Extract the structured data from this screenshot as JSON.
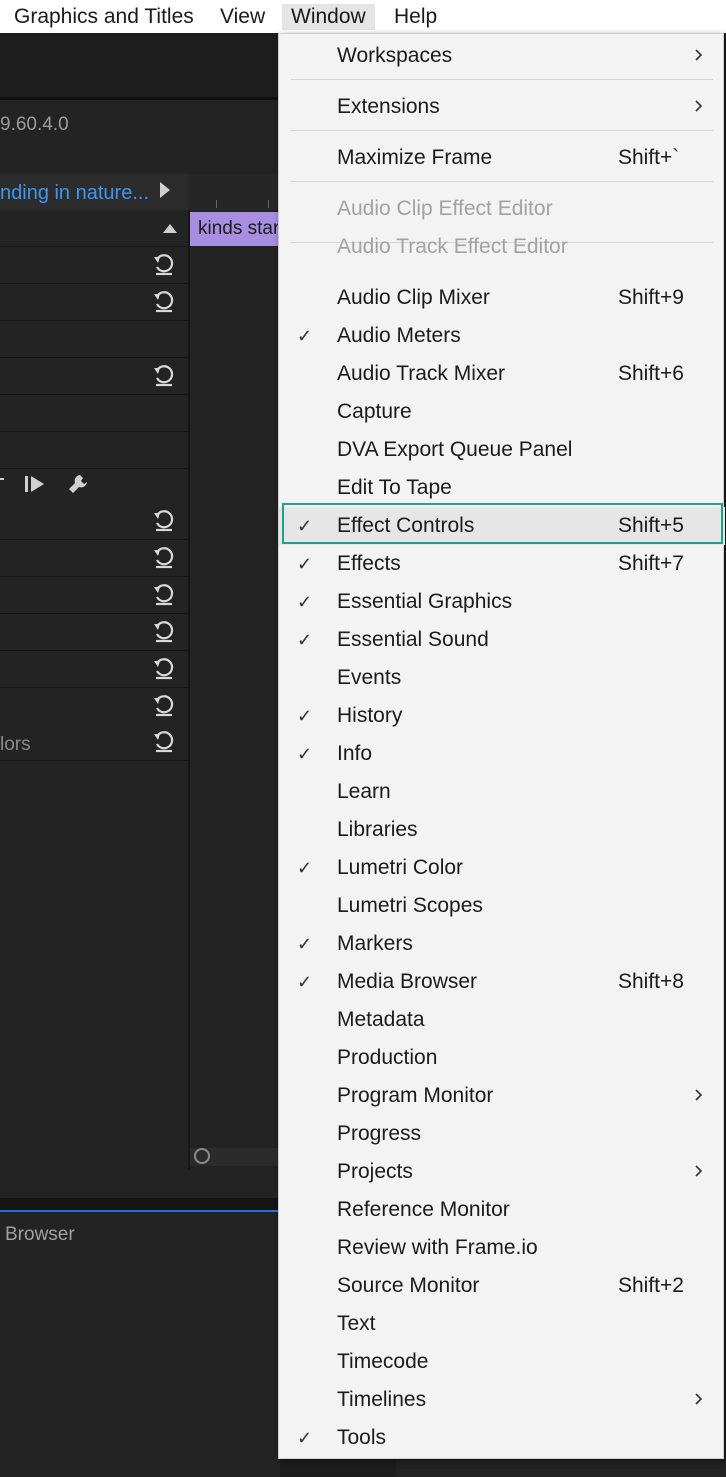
{
  "menubar": {
    "items": [
      "Graphics and Titles",
      "View",
      "Window",
      "Help"
    ]
  },
  "panel": {
    "version": "9.60.4.0",
    "clip_title": "nding in nature...",
    "timeline_clip": "kinds star",
    "row_label": "lors",
    "browser_tab": "Browser"
  },
  "window_menu": {
    "items": [
      {
        "label": "Workspaces",
        "shortcut": "",
        "checked": false,
        "submenu": true,
        "disabled": false
      },
      {
        "label": "Extensions",
        "shortcut": "",
        "checked": false,
        "submenu": true,
        "disabled": false
      },
      {
        "label": "Maximize Frame",
        "shortcut": "Shift+`",
        "checked": false,
        "submenu": false,
        "disabled": false
      },
      {
        "label": "Audio Clip Effect Editor",
        "shortcut": "",
        "checked": false,
        "submenu": false,
        "disabled": true
      },
      {
        "label": "Audio Track Effect Editor",
        "shortcut": "",
        "checked": false,
        "submenu": false,
        "disabled": true
      },
      {
        "label": "Audio Clip Mixer",
        "shortcut": "Shift+9",
        "checked": false,
        "submenu": false,
        "disabled": false
      },
      {
        "label": "Audio Meters",
        "shortcut": "",
        "checked": true,
        "submenu": false,
        "disabled": false
      },
      {
        "label": "Audio Track Mixer",
        "shortcut": "Shift+6",
        "checked": false,
        "submenu": false,
        "disabled": false
      },
      {
        "label": "Capture",
        "shortcut": "",
        "checked": false,
        "submenu": false,
        "disabled": false
      },
      {
        "label": "DVA Export Queue Panel",
        "shortcut": "",
        "checked": false,
        "submenu": false,
        "disabled": false
      },
      {
        "label": "Edit To Tape",
        "shortcut": "",
        "checked": false,
        "submenu": false,
        "disabled": false
      },
      {
        "label": "Effect Controls",
        "shortcut": "Shift+5",
        "checked": true,
        "submenu": false,
        "disabled": false
      },
      {
        "label": "Effects",
        "shortcut": "Shift+7",
        "checked": true,
        "submenu": false,
        "disabled": false
      },
      {
        "label": "Essential Graphics",
        "shortcut": "",
        "checked": true,
        "submenu": false,
        "disabled": false
      },
      {
        "label": "Essential Sound",
        "shortcut": "",
        "checked": true,
        "submenu": false,
        "disabled": false
      },
      {
        "label": "Events",
        "shortcut": "",
        "checked": false,
        "submenu": false,
        "disabled": false
      },
      {
        "label": "History",
        "shortcut": "",
        "checked": true,
        "submenu": false,
        "disabled": false
      },
      {
        "label": "Info",
        "shortcut": "",
        "checked": true,
        "submenu": false,
        "disabled": false
      },
      {
        "label": "Learn",
        "shortcut": "",
        "checked": false,
        "submenu": false,
        "disabled": false
      },
      {
        "label": "Libraries",
        "shortcut": "",
        "checked": false,
        "submenu": false,
        "disabled": false
      },
      {
        "label": "Lumetri Color",
        "shortcut": "",
        "checked": true,
        "submenu": false,
        "disabled": false
      },
      {
        "label": "Lumetri Scopes",
        "shortcut": "",
        "checked": false,
        "submenu": false,
        "disabled": false
      },
      {
        "label": "Markers",
        "shortcut": "",
        "checked": true,
        "submenu": false,
        "disabled": false
      },
      {
        "label": "Media Browser",
        "shortcut": "Shift+8",
        "checked": true,
        "submenu": false,
        "disabled": false
      },
      {
        "label": "Metadata",
        "shortcut": "",
        "checked": false,
        "submenu": false,
        "disabled": false
      },
      {
        "label": "Production",
        "shortcut": "",
        "checked": false,
        "submenu": false,
        "disabled": false
      },
      {
        "label": "Program Monitor",
        "shortcut": "",
        "checked": false,
        "submenu": true,
        "disabled": false
      },
      {
        "label": "Progress",
        "shortcut": "",
        "checked": false,
        "submenu": false,
        "disabled": false
      },
      {
        "label": "Projects",
        "shortcut": "",
        "checked": false,
        "submenu": true,
        "disabled": false
      },
      {
        "label": "Reference Monitor",
        "shortcut": "",
        "checked": false,
        "submenu": false,
        "disabled": false
      },
      {
        "label": "Review with Frame.io",
        "shortcut": "",
        "checked": false,
        "submenu": false,
        "disabled": false
      },
      {
        "label": "Source Monitor",
        "shortcut": "Shift+2",
        "checked": false,
        "submenu": false,
        "disabled": false
      },
      {
        "label": "Text",
        "shortcut": "",
        "checked": false,
        "submenu": false,
        "disabled": false
      },
      {
        "label": "Timecode",
        "shortcut": "",
        "checked": false,
        "submenu": false,
        "disabled": false
      },
      {
        "label": "Timelines",
        "shortcut": "",
        "checked": false,
        "submenu": true,
        "disabled": false
      },
      {
        "label": "Tools",
        "shortcut": "",
        "checked": true,
        "submenu": false,
        "disabled": false
      }
    ]
  },
  "highlighted_item": "Effect Controls",
  "colors": {
    "menu_bg": "#f3f3f3",
    "highlight_border": "#1fa184",
    "clip_title": "#3d96f0",
    "timeline_clip": "#a78ee0"
  }
}
